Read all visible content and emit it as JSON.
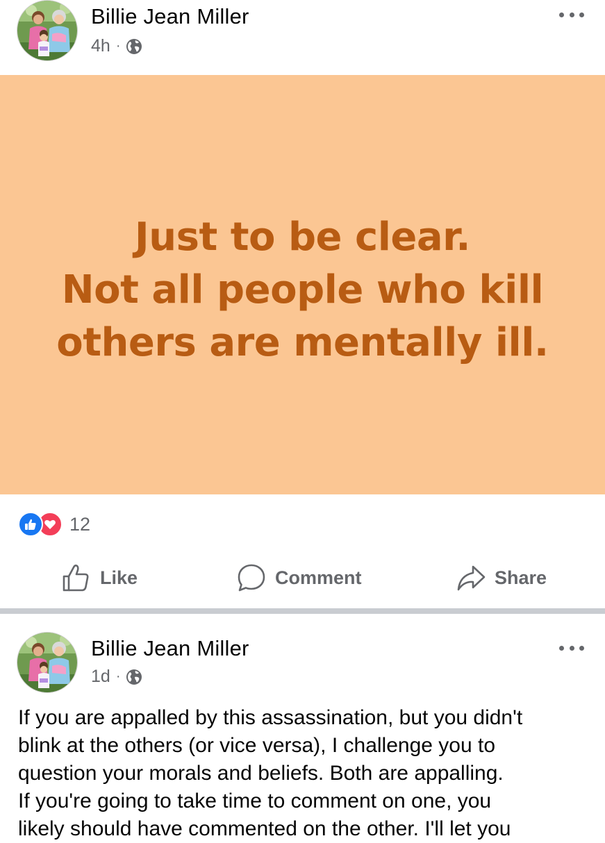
{
  "posts": [
    {
      "author": "Billie Jean Miller",
      "time": "4h",
      "separator": "·",
      "privacy_icon": "globe-icon",
      "more_icon": "more-horizontal-icon",
      "card": {
        "background": "#fbc693",
        "text_color": "#b85c13",
        "lines": [
          "Just to be clear.",
          "Not all people who kill",
          "others are mentally ill."
        ]
      },
      "reactions": {
        "icons": [
          "like-reaction-icon",
          "love-reaction-icon"
        ],
        "count": "12"
      },
      "actions": {
        "like": "Like",
        "comment": "Comment",
        "share": "Share"
      }
    },
    {
      "author": "Billie Jean Miller",
      "time": "1d",
      "separator": "·",
      "privacy_icon": "globe-icon",
      "more_icon": "more-horizontal-icon",
      "text_lines": [
        "If you are appalled by this assassination, but you didn't",
        "blink at the others (or vice versa), I challenge you to",
        "question your morals and beliefs.  Both are appalling.",
        "If you're going to take time to comment on one, you",
        "likely should have commented on the other.  I'll let you"
      ]
    }
  ],
  "colors": {
    "like_blue": "#1877f2",
    "love_red": "#f33e58",
    "secondary_text": "#65676b",
    "separator": "#c9ccd1"
  }
}
